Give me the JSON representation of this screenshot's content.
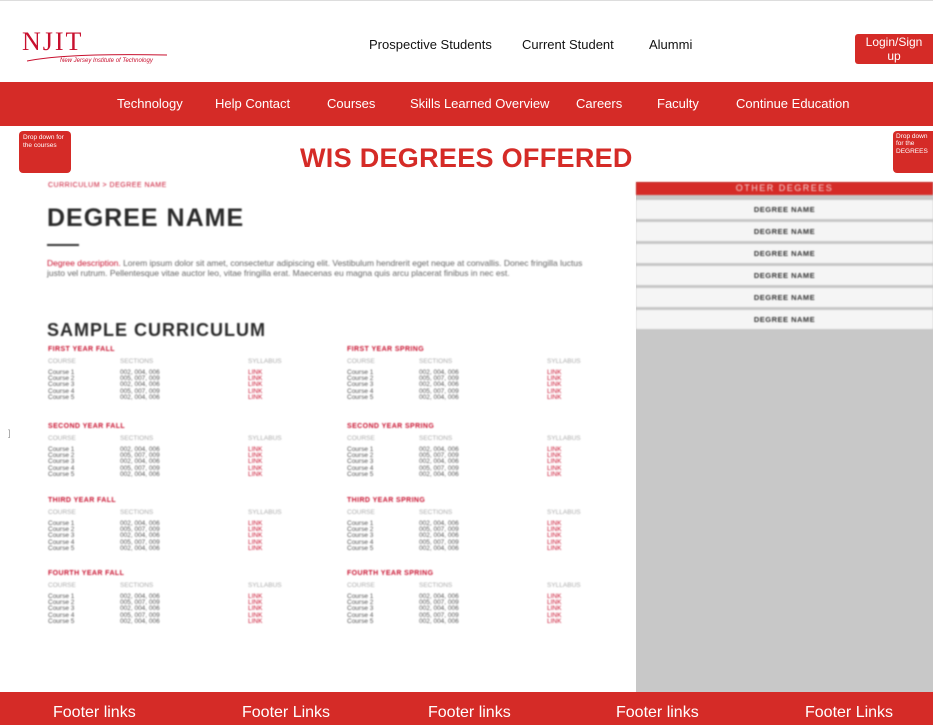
{
  "header": {
    "logo_text": "NJIT",
    "logo_subtitle": "New Jersey Institute of Technology",
    "links": [
      "Prospective Students",
      "Current Student",
      "Alummi"
    ],
    "login_label": "Login/Sign up"
  },
  "nav": {
    "items": [
      "Technology",
      "Help Contact",
      "Courses",
      "Skills Learned Overview",
      "Careers",
      "Faculty",
      "Continue Education"
    ]
  },
  "dropdowns": {
    "left": "Drop down for the courses",
    "right": "Drop down for the DEGREES"
  },
  "hero": {
    "title": "WIS DEGREES OFFERED"
  },
  "main": {
    "breadcrumb": "CURRICULUM  > DEGREE NAME",
    "degree_title": "DEGREE NAME",
    "description_lead": "Degree description.",
    "description_body": " Lorem ipsum dolor sit amet, consectetur adipiscing elit. Vestibulum hendrerit eget neque at convallis. Donec fringilla luctus justo vel rutrum. Pellentesque vitae auctor leo, vitae fringilla erat. Maecenas eu magna quis arcu placerat finibus in nec est.",
    "sample_title": "SAMPLE CURRICULUM",
    "columns": {
      "course": "COURSE",
      "sections": "SECTIONS",
      "syllabus": "SYLLABUS"
    },
    "semesters": [
      {
        "title": "FIRST YEAR FALL",
        "rows": [
          [
            "Course 1",
            "002, 004, 006",
            "LINK"
          ],
          [
            "Course 2",
            "005, 007, 009",
            "LINK"
          ],
          [
            "Course 3",
            "002, 004, 006",
            "LINK"
          ],
          [
            "Course 4",
            "005, 007, 009",
            "LINK"
          ],
          [
            "Course 5",
            "002, 004, 006",
            "LINK"
          ]
        ]
      },
      {
        "title": "FIRST YEAR SPRING",
        "rows": [
          [
            "Course 1",
            "002, 004, 006",
            "LINK"
          ],
          [
            "Course 2",
            "005, 007, 009",
            "LINK"
          ],
          [
            "Course 3",
            "002, 004, 006",
            "LINK"
          ],
          [
            "Course 4",
            "005, 007, 009",
            "LINK"
          ],
          [
            "Course 5",
            "002, 004, 006",
            "LINK"
          ]
        ]
      },
      {
        "title": "SECOND YEAR FALL",
        "rows": [
          [
            "Course 1",
            "002, 004, 006",
            "LINK"
          ],
          [
            "Course 2",
            "005, 007, 009",
            "LINK"
          ],
          [
            "Course 3",
            "002, 004, 006",
            "LINK"
          ],
          [
            "Course 4",
            "005, 007, 009",
            "LINK"
          ],
          [
            "Course 5",
            "002, 004, 006",
            "LINK"
          ]
        ]
      },
      {
        "title": "SECOND YEAR SPRING",
        "rows": [
          [
            "Course 1",
            "002, 004, 006",
            "LINK"
          ],
          [
            "Course 2",
            "005, 007, 009",
            "LINK"
          ],
          [
            "Course 3",
            "002, 004, 006",
            "LINK"
          ],
          [
            "Course 4",
            "005, 007, 009",
            "LINK"
          ],
          [
            "Course 5",
            "002, 004, 006",
            "LINK"
          ]
        ]
      },
      {
        "title": "THIRD YEAR FALL",
        "rows": [
          [
            "Course 1",
            "002, 004, 006",
            "LINK"
          ],
          [
            "Course 2",
            "005, 007, 009",
            "LINK"
          ],
          [
            "Course 3",
            "002, 004, 006",
            "LINK"
          ],
          [
            "Course 4",
            "005, 007, 009",
            "LINK"
          ],
          [
            "Course 5",
            "002, 004, 006",
            "LINK"
          ]
        ]
      },
      {
        "title": "THIRD YEAR SPRING",
        "rows": [
          [
            "Course 1",
            "002, 004, 006",
            "LINK"
          ],
          [
            "Course 2",
            "005, 007, 009",
            "LINK"
          ],
          [
            "Course 3",
            "002, 004, 006",
            "LINK"
          ],
          [
            "Course 4",
            "005, 007, 009",
            "LINK"
          ],
          [
            "Course 5",
            "002, 004, 006",
            "LINK"
          ]
        ]
      },
      {
        "title": "FOURTH YEAR FALL",
        "rows": [
          [
            "Course 1",
            "002, 004, 006",
            "LINK"
          ],
          [
            "Course 2",
            "005, 007, 009",
            "LINK"
          ],
          [
            "Course 3",
            "002, 004, 006",
            "LINK"
          ],
          [
            "Course 4",
            "005, 007, 009",
            "LINK"
          ],
          [
            "Course 5",
            "002, 004, 006",
            "LINK"
          ]
        ]
      },
      {
        "title": "FOURTH YEAR SPRING",
        "rows": [
          [
            "Course 1",
            "002, 004, 006",
            "LINK"
          ],
          [
            "Course 2",
            "005, 007, 009",
            "LINK"
          ],
          [
            "Course 3",
            "002, 004, 006",
            "LINK"
          ],
          [
            "Course 4",
            "005, 007, 009",
            "LINK"
          ],
          [
            "Course 5",
            "002, 004, 006",
            "LINK"
          ]
        ]
      }
    ]
  },
  "sidebar": {
    "header": "OTHER DEGREES",
    "items": [
      "DEGREE NAME",
      "DEGREE NAME",
      "DEGREE NAME",
      "DEGREE NAME",
      "DEGREE NAME",
      "DEGREE NAME"
    ]
  },
  "footer": {
    "links": [
      "Footer links",
      "Footer Links",
      "Footer links",
      "Footer links",
      "Footer Links"
    ]
  },
  "colors": {
    "brand_red": "#d52b27",
    "sidebar_gray": "#c8c8c8"
  }
}
